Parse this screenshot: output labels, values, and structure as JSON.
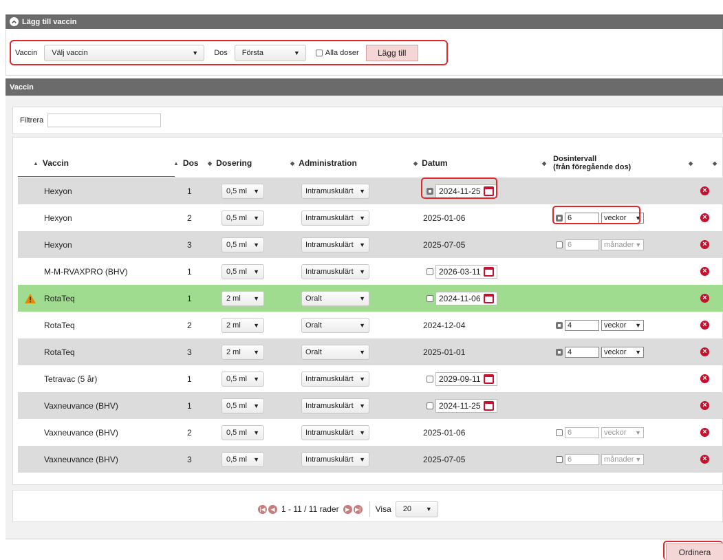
{
  "add_panel": {
    "title": "Lägg till vaccin",
    "vaccine_label": "Vaccin",
    "vaccine_select": "Välj vaccin",
    "dose_label": "Dos",
    "dose_select": "Första",
    "all_doses_label": "Alla doser",
    "add_button": "Lägg till"
  },
  "vaccine_panel": {
    "title": "Vaccin",
    "filter_label": "Filtrera",
    "filter_value": ""
  },
  "table": {
    "columns": {
      "vaccine": "Vaccin",
      "dose": "Dos",
      "dosage": "Dosering",
      "administration": "Administration",
      "date": "Datum",
      "interval_line1": "Dosintervall",
      "interval_line2": "(från föregående dos)"
    },
    "rows": [
      {
        "vaccine": "Hexyon",
        "dose": "1",
        "dosage": "0,5 ml",
        "administration": "Intramuskulärt",
        "date": "2024-11-25",
        "date_editable": true,
        "date_checked": true,
        "interval_value": "",
        "interval_unit": ""
      },
      {
        "vaccine": "Hexyon",
        "dose": "2",
        "dosage": "0,5 ml",
        "administration": "Intramuskulärt",
        "date": "2025-01-06",
        "date_editable": false,
        "interval_value": "6",
        "interval_unit": "veckor",
        "interval_checked": true
      },
      {
        "vaccine": "Hexyon",
        "dose": "3",
        "dosage": "0,5 ml",
        "administration": "Intramuskulärt",
        "date": "2025-07-05",
        "date_editable": false,
        "interval_value": "6",
        "interval_unit": "månader",
        "interval_checked": false
      },
      {
        "vaccine": "M-M-RVAXPRO (BHV)",
        "dose": "1",
        "dosage": "0,5 ml",
        "administration": "Intramuskulärt",
        "date": "2026-03-11",
        "date_editable": true,
        "date_checked": false,
        "interval_value": "",
        "interval_unit": ""
      },
      {
        "vaccine": "RotaTeq",
        "dose": "1",
        "dosage": "2 ml",
        "administration": "Oralt",
        "date": "2024-11-06",
        "date_editable": true,
        "date_checked": false,
        "interval_value": "",
        "interval_unit": "",
        "warning": true
      },
      {
        "vaccine": "RotaTeq",
        "dose": "2",
        "dosage": "2 ml",
        "administration": "Oralt",
        "date": "2024-12-04",
        "date_editable": false,
        "interval_value": "4",
        "interval_unit": "veckor",
        "interval_checked": true
      },
      {
        "vaccine": "RotaTeq",
        "dose": "3",
        "dosage": "2 ml",
        "administration": "Oralt",
        "date": "2025-01-01",
        "date_editable": false,
        "interval_value": "4",
        "interval_unit": "veckor",
        "interval_checked": true
      },
      {
        "vaccine": "Tetravac (5 år)",
        "dose": "1",
        "dosage": "0,5 ml",
        "administration": "Intramuskulärt",
        "date": "2029-09-11",
        "date_editable": true,
        "date_checked": false,
        "interval_value": "",
        "interval_unit": ""
      },
      {
        "vaccine": "Vaxneuvance (BHV)",
        "dose": "1",
        "dosage": "0,5 ml",
        "administration": "Intramuskulärt",
        "date": "2024-11-25",
        "date_editable": true,
        "date_checked": false,
        "interval_value": "",
        "interval_unit": ""
      },
      {
        "vaccine": "Vaxneuvance (BHV)",
        "dose": "2",
        "dosage": "0,5 ml",
        "administration": "Intramuskulärt",
        "date": "2025-01-06",
        "date_editable": false,
        "interval_value": "6",
        "interval_unit": "veckor",
        "interval_checked": false
      },
      {
        "vaccine": "Vaxneuvance (BHV)",
        "dose": "3",
        "dosage": "0,5 ml",
        "administration": "Intramuskulärt",
        "date": "2025-07-05",
        "date_editable": false,
        "interval_value": "6",
        "interval_unit": "månader",
        "interval_checked": false
      }
    ]
  },
  "pager": {
    "range_text": "1 - 11 / 11 rader",
    "show_label": "Visa",
    "page_size": "20"
  },
  "footer": {
    "order_button": "Ordinera"
  },
  "colors": {
    "header_bg": "#6b6b6b",
    "highlight": "#e2262b",
    "warning_row": "#9fdc8f",
    "delete_icon": "#c8102e"
  }
}
